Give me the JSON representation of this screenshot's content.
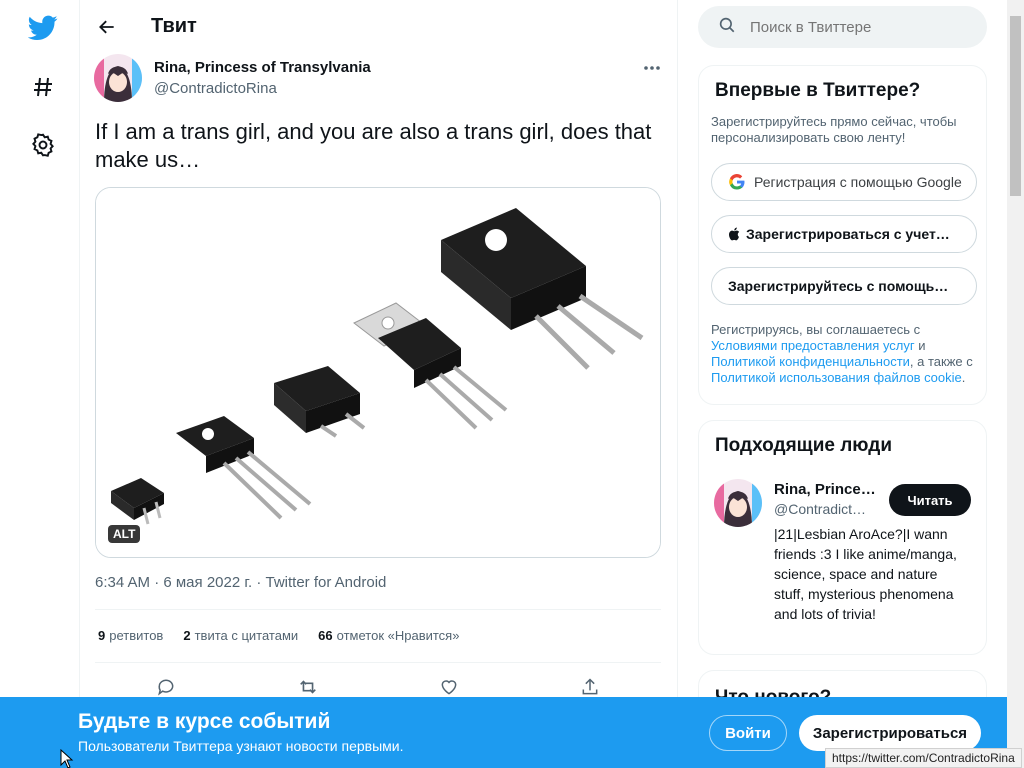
{
  "colors": {
    "brand": "#1d9bf0",
    "text": "#0f1419",
    "muted": "#536471"
  },
  "nav": {
    "icons": [
      "twitter-logo-icon",
      "hashtag-icon",
      "settings-icon"
    ]
  },
  "header": {
    "title": "Твит"
  },
  "tweet": {
    "author_name": "Rina, Princess of Transylvania",
    "author_handle": "@ContradictoRina",
    "text": "If I am a trans girl, and you are also a trans girl, does that make us…",
    "alt_badge": "ALT",
    "meta": "6:34 AM · 6 мая 2022 г. · Twitter for Android",
    "stats": [
      {
        "count": "9",
        "label": "ретвитов"
      },
      {
        "count": "2",
        "label": "твита с цитатами"
      },
      {
        "count": "66",
        "label": "отметок «Нравится»"
      }
    ]
  },
  "search": {
    "placeholder": "Поиск в Твиттере"
  },
  "signup_card": {
    "title": "Впервые в Твиттере?",
    "desc": "Зарегистрируйтесь прямо сейчас, чтобы персонализировать свою ленту!",
    "google": "Регистрация с помощью Google",
    "apple": "Зарегистрироваться с учет…",
    "other": "Зарегистрируйтесь с помощь…",
    "terms_1": "Регистрируясь, вы соглашаетесь с ",
    "terms_link_1": "Условиями предоставления услуг",
    "terms_2": " и ",
    "terms_link_2": "Политикой конфиденциальности",
    "terms_3": ", а также с ",
    "terms_link_3": "Политикой использования файлов cookie",
    "terms_4": "."
  },
  "people_card": {
    "title": "Подходящие люди",
    "name": "Rina, Prince…",
    "handle": "@Contradict…",
    "follow": "Читать",
    "bio": "|21|Lesbian AroAce?|I wann friends :3 I like anime/manga, science, space and nature stuff, mysterious phenomena and lots of trivia!"
  },
  "next_card": {
    "title": "Что нового?"
  },
  "bottom_bar": {
    "title": "Будьте в курсе событий",
    "subtitle": "Пользователи Твиттера узнают новости первыми.",
    "login": "Войти",
    "signup": "Зарегистрироваться"
  },
  "status_url": "https://twitter.com/ContradictoRina"
}
